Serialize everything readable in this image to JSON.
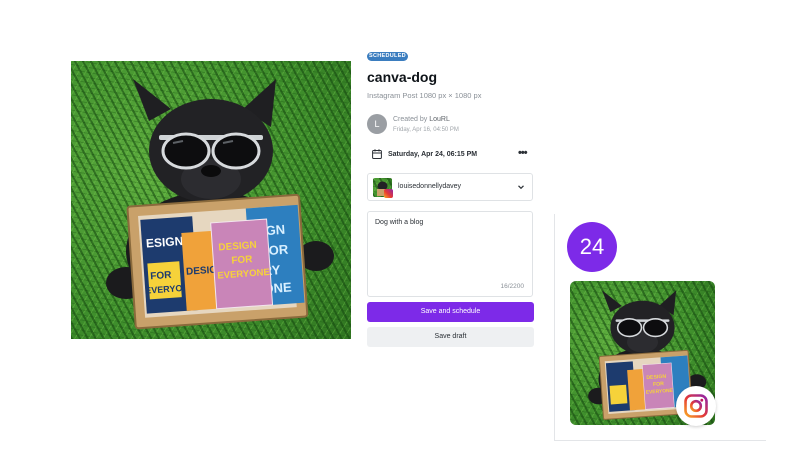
{
  "post": {
    "status": "SCHEDULED",
    "title": "canva-dog",
    "subtitle": "Instagram Post 1080 px × 1080 px",
    "creator_avatar_initial": "L",
    "created_by_prefix": "Created by",
    "creator_name": "LouRL",
    "created_date": "Friday, Apr 16, 04:50 PM",
    "scheduled_date": "Saturday, Apr 24, 06:15 PM",
    "more_label": "•••",
    "account_name": "louisedonnellydavey",
    "caption": "Dog with a blog",
    "char_count": "16/2200",
    "save_schedule_label": "Save and schedule",
    "save_draft_label": "Save draft"
  },
  "illustration": {
    "sign_cards": [
      {
        "lines": [
          "DESIGN",
          "FOR",
          "EVERYONE"
        ],
        "color": "#c985b8",
        "text_color": "#f6d23a"
      },
      {
        "lines": [
          "ESIGN"
        ],
        "color": "#1d3b6e",
        "text_color": "#ffffff"
      },
      {
        "lines": [
          "DESIGN",
          "FOR",
          "EVERYONE"
        ],
        "color": "#2d7fbf",
        "text_color": "#d9f0ff"
      }
    ]
  },
  "calendar": {
    "day_number": "24"
  },
  "colors": {
    "accent": "#7d2ae8",
    "badge": "#3b7dbf",
    "grass": "#3f8f2c"
  },
  "icons": [
    "calendar-icon",
    "chevron-down-icon",
    "instagram-icon",
    "more-icon"
  ]
}
